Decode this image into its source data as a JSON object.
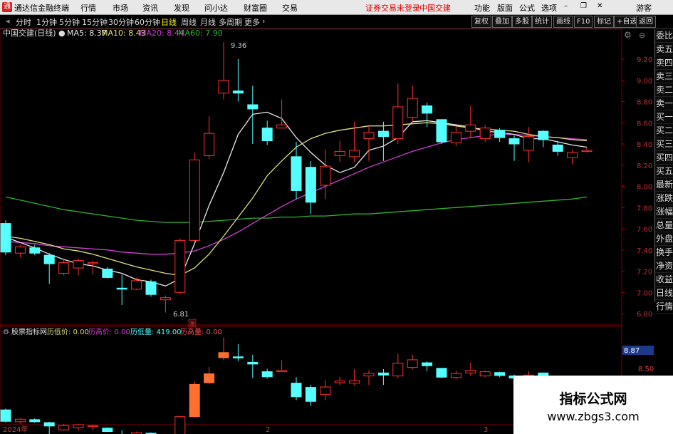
{
  "topbar": {
    "app_title": "通达信金融终端",
    "menus": [
      "行情",
      "市场",
      "资讯",
      "发现",
      "问小达",
      "财富圈",
      "交易"
    ],
    "status_text": "证券交易未登录",
    "stock_title": "中国交建",
    "right_menus": [
      "功能",
      "版面",
      "公式",
      "选项"
    ],
    "guest": "游客"
  },
  "toolbar": {
    "periods": [
      "分时",
      "1分钟",
      "5分钟",
      "15分钟",
      "30分钟",
      "60分钟",
      "日线",
      "周线",
      "月线",
      "多周期",
      "更多"
    ],
    "active_period": "日线",
    "right_buttons": [
      "复权",
      "叠加",
      "多股",
      "统计",
      "画线",
      "F10",
      "标记",
      "+自选",
      "返回"
    ]
  },
  "chart_header": {
    "stock": "中国交建(日线)",
    "ma5": "MA5: 8.37",
    "ma10": "MA10: 8.43",
    "ma20": "MA20: 8.44",
    "ma60": "MA60: 7.90"
  },
  "right_panel": [
    "委比",
    "卖五",
    "卖四",
    "卖三",
    "卖二",
    "卖一",
    "买一",
    "买二",
    "买三",
    "买四",
    "买五",
    "最新",
    "涨跌",
    "涨幅",
    "总量",
    "外盘",
    "换手",
    "净资",
    "收益",
    "日线",
    "行情"
  ],
  "sub_header": {
    "name": "股票指标网",
    "low_price": "历低价: 0.00",
    "high_price": "历高价: 0.00",
    "low_vol": "历低量: 419.00",
    "high_vol": "历高量: 0.00"
  },
  "annotations": {
    "max": "9.36",
    "min": "6.81",
    "badge": "涨"
  },
  "sub_axis": {
    "highlight": "8.87",
    "label": "8.50"
  },
  "date_labels": [
    "2024年",
    "2",
    "3"
  ],
  "watermark": {
    "line1": "指标公式网",
    "line2": "www.zbgs3.com"
  },
  "colors": {
    "up": "#ff3030",
    "down": "#55ffff",
    "ma5": "#e8e8e8",
    "ma10": "#e0e080",
    "ma20": "#d040d0",
    "ma60": "#30b030"
  },
  "chart_data": {
    "type": "candlestick",
    "y_ticks": [
      9.2,
      9.0,
      8.8,
      8.6,
      8.4,
      8.2,
      8.0,
      7.8,
      7.6,
      7.4,
      7.2,
      7.0,
      6.8
    ],
    "candles": [
      [
        7.65,
        7.38,
        7.68,
        7.35
      ],
      [
        7.37,
        7.43,
        7.45,
        7.33
      ],
      [
        7.42,
        7.37,
        7.45,
        7.35
      ],
      [
        7.35,
        7.27,
        7.37,
        7.08
      ],
      [
        7.18,
        7.28,
        7.32,
        7.16
      ],
      [
        7.23,
        7.3,
        7.32,
        7.16
      ],
      [
        7.27,
        7.28,
        7.3,
        7.17
      ],
      [
        7.22,
        7.14,
        7.24,
        7.13
      ],
      [
        7.04,
        7.03,
        7.17,
        6.88
      ],
      [
        7.03,
        7.11,
        7.14,
        7.02
      ],
      [
        7.1,
        6.98,
        7.12,
        6.96
      ],
      [
        6.93,
        6.95,
        6.97,
        6.81
      ],
      [
        7.0,
        7.49,
        7.51,
        6.98
      ],
      [
        7.49,
        8.25,
        8.32,
        7.48
      ],
      [
        8.29,
        8.5,
        8.66,
        8.26
      ],
      [
        8.88,
        9.0,
        9.36,
        8.82
      ],
      [
        8.9,
        8.88,
        9.2,
        8.8
      ],
      [
        8.77,
        8.73,
        8.95,
        8.4
      ],
      [
        8.55,
        8.43,
        8.62,
        8.39
      ],
      [
        8.55,
        8.58,
        8.82,
        8.55
      ],
      [
        8.28,
        7.96,
        8.42,
        7.88
      ],
      [
        8.18,
        7.85,
        8.24,
        7.74
      ],
      [
        8.01,
        8.19,
        8.35,
        7.88
      ],
      [
        8.29,
        8.33,
        8.43,
        8.23
      ],
      [
        8.28,
        8.34,
        8.61,
        8.23
      ],
      [
        8.45,
        8.51,
        8.58,
        8.24
      ],
      [
        8.52,
        8.47,
        8.61,
        8.24
      ],
      [
        8.45,
        8.75,
        8.97,
        8.4
      ],
      [
        8.65,
        8.83,
        8.95,
        8.6
      ],
      [
        8.76,
        8.69,
        8.79,
        8.56
      ],
      [
        8.63,
        8.42,
        8.63,
        8.4
      ],
      [
        8.41,
        8.51,
        8.57,
        8.38
      ],
      [
        8.52,
        8.58,
        8.76,
        8.46
      ],
      [
        8.45,
        8.55,
        8.58,
        8.42
      ],
      [
        8.53,
        8.46,
        8.55,
        8.42
      ],
      [
        8.45,
        8.4,
        8.48,
        8.24
      ],
      [
        8.34,
        8.47,
        8.56,
        8.23
      ],
      [
        8.52,
        8.44,
        8.53,
        8.37
      ],
      [
        8.39,
        8.33,
        8.43,
        8.29
      ],
      [
        8.27,
        8.32,
        8.35,
        8.21
      ],
      [
        8.33,
        8.34,
        8.37,
        8.32
      ]
    ],
    "ma5": [
      7.52,
      7.47,
      7.42,
      7.36,
      7.31,
      7.27,
      7.25,
      7.21,
      7.18,
      7.12,
      7.1,
      7.06,
      7.13,
      7.46,
      7.82,
      8.13,
      8.49,
      8.68,
      8.7,
      8.64,
      8.46,
      8.32,
      8.2,
      8.13,
      8.18,
      8.34,
      8.38,
      8.46,
      8.61,
      8.62,
      8.6,
      8.58,
      8.56,
      8.52,
      8.51,
      8.49,
      8.45,
      8.45,
      8.42,
      8.39,
      8.37
    ],
    "ma10": [
      7.53,
      7.51,
      7.48,
      7.45,
      7.41,
      7.39,
      7.36,
      7.32,
      7.28,
      7.24,
      7.21,
      7.18,
      7.16,
      7.23,
      7.36,
      7.53,
      7.71,
      7.89,
      8.1,
      8.24,
      8.37,
      8.45,
      8.5,
      8.53,
      8.55,
      8.57,
      8.57,
      8.58,
      8.59,
      8.6,
      8.59,
      8.57,
      8.55,
      8.54,
      8.53,
      8.52,
      8.49,
      8.47,
      8.46,
      8.44,
      8.43
    ],
    "ma20": [
      7.48,
      7.47,
      7.46,
      7.44,
      7.43,
      7.42,
      7.41,
      7.4,
      7.38,
      7.37,
      7.36,
      7.36,
      7.37,
      7.39,
      7.44,
      7.5,
      7.57,
      7.65,
      7.73,
      7.81,
      7.88,
      7.94,
      8.0,
      8.06,
      8.12,
      8.18,
      8.23,
      8.28,
      8.33,
      8.37,
      8.41,
      8.44,
      8.46,
      8.48,
      8.49,
      8.49,
      8.48,
      8.47,
      8.46,
      8.45,
      8.44
    ],
    "ma60": [
      7.9,
      7.87,
      7.84,
      7.81,
      7.78,
      7.76,
      7.74,
      7.72,
      7.7,
      7.68,
      7.67,
      7.66,
      7.66,
      7.66,
      7.67,
      7.68,
      7.69,
      7.7,
      7.7,
      7.71,
      7.71,
      7.72,
      7.72,
      7.73,
      7.74,
      7.74,
      7.75,
      7.76,
      7.77,
      7.78,
      7.79,
      7.8,
      7.81,
      7.82,
      7.83,
      7.84,
      7.85,
      7.86,
      7.87,
      7.88,
      7.9
    ]
  }
}
